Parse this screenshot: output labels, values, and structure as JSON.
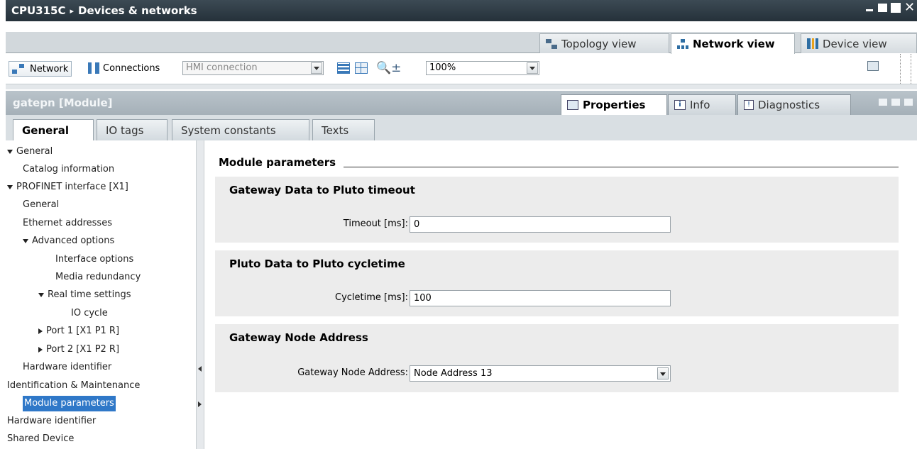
{
  "window": {
    "title_parts": [
      "CPU315C",
      "Devices & networks"
    ],
    "separator": "▸"
  },
  "views": [
    {
      "label": "Topology view",
      "icon": "topology-icon"
    },
    {
      "label": "Network view",
      "icon": "network-view-icon",
      "active": true
    },
    {
      "label": "Device view",
      "icon": "device-view-icon"
    }
  ],
  "toolbar": {
    "network_label": "Network",
    "connections_label": "Connections",
    "connection_type": "HMI connection",
    "zoom_value": "100%"
  },
  "inspector": {
    "title": "gatepn [Module]",
    "tabs": [
      {
        "label": "Properties",
        "active": true
      },
      {
        "label": "Info"
      },
      {
        "label": "Diagnostics"
      }
    ],
    "subtabs": [
      {
        "label": "General",
        "active": true
      },
      {
        "label": "IO tags"
      },
      {
        "label": "System constants"
      },
      {
        "label": "Texts"
      }
    ]
  },
  "nav": [
    {
      "label": "General",
      "level": 0,
      "expander": "down"
    },
    {
      "label": "Catalog information",
      "level": 1
    },
    {
      "label": "PROFINET interface [X1]",
      "level": 0,
      "expander": "down"
    },
    {
      "label": "General",
      "level": 1
    },
    {
      "label": "Ethernet addresses",
      "level": 1
    },
    {
      "label": "Advanced options",
      "level": 1,
      "expander": "down"
    },
    {
      "label": "Interface options",
      "level": 2
    },
    {
      "label": "Media redundancy",
      "level": 2
    },
    {
      "label": "Real time settings",
      "level": 2,
      "expander": "down"
    },
    {
      "label": "IO cycle",
      "level": 3
    },
    {
      "label": "Port 1 [X1 P1 R]",
      "level": 2,
      "expander": "right"
    },
    {
      "label": "Port 2 [X1 P2 R]",
      "level": 2,
      "expander": "right"
    },
    {
      "label": "Hardware identifier",
      "level": 1
    },
    {
      "label": "Identification & Maintenance",
      "level": 0
    },
    {
      "label": "Module parameters",
      "level": 0,
      "selected": true
    },
    {
      "label": "Hardware identifier",
      "level": 0
    },
    {
      "label": "Shared Device",
      "level": 0
    }
  ],
  "content": {
    "heading": "Module parameters",
    "groups": [
      {
        "title": "Gateway Data to Pluto timeout",
        "field_label": "Timeout [ms]:",
        "value": "0"
      },
      {
        "title": "Pluto Data to Pluto cycletime",
        "field_label": "Cycletime [ms]:",
        "value": "100"
      },
      {
        "title": "Gateway Node Address",
        "field_label": "Gateway Node Address:",
        "value": "Node Address 13"
      }
    ]
  },
  "colors": {
    "titlebar": "#2e3a43",
    "selection": "#2f78c8",
    "group_bg": "#ececec"
  }
}
